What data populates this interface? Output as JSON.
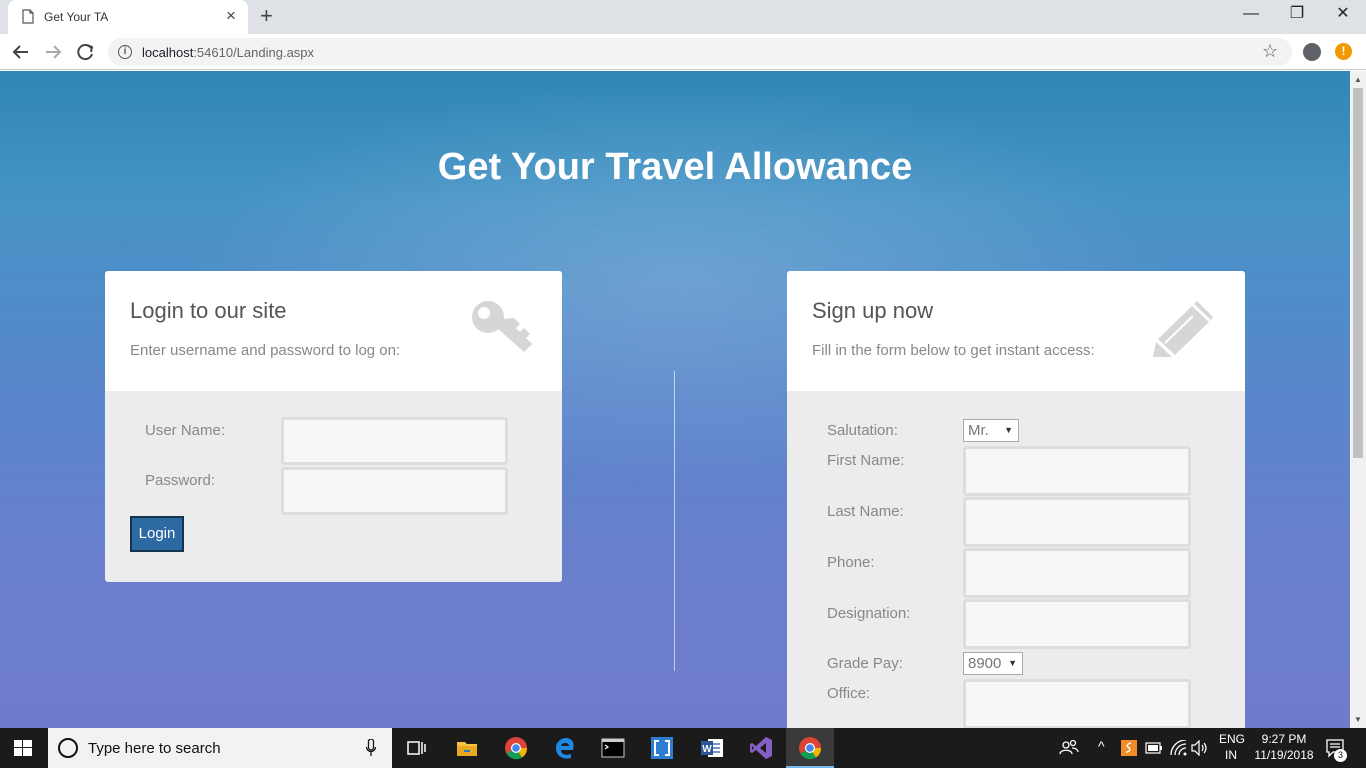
{
  "browser": {
    "tab_title": "Get Your TA",
    "url_host": "localhost",
    "url_path": ":54610/Landing.aspx",
    "new_tab_label": "+",
    "close_label": "×"
  },
  "page": {
    "title": "Get Your Travel Allowance"
  },
  "login": {
    "heading": "Login to our site",
    "subheading": "Enter username and password to log on:",
    "icon": "key-icon",
    "username_label": "User Name:",
    "password_label": "Password:",
    "username_value": "",
    "password_value": "",
    "button_label": "Login"
  },
  "signup": {
    "heading": "Sign up now",
    "subheading": "Fill in the form below to get instant access:",
    "icon": "pencil-icon",
    "salutation_label": "Salutation:",
    "salutation_value": "Mr.",
    "first_name_label": "First Name:",
    "last_name_label": "Last Name:",
    "phone_label": "Phone:",
    "designation_label": "Designation:",
    "grade_pay_label": "Grade Pay:",
    "grade_pay_value": "8900",
    "office_label": "Office:"
  },
  "taskbar": {
    "search_placeholder": "Type here to search",
    "lang_top": "ENG",
    "lang_bottom": "IN",
    "time": "9:27 PM",
    "date": "11/19/2018",
    "notification_count": "3"
  },
  "colors": {
    "accent": "#2d6aa3",
    "bg_top": "#2f87b6",
    "bg_bottom": "#6f7ccb"
  }
}
